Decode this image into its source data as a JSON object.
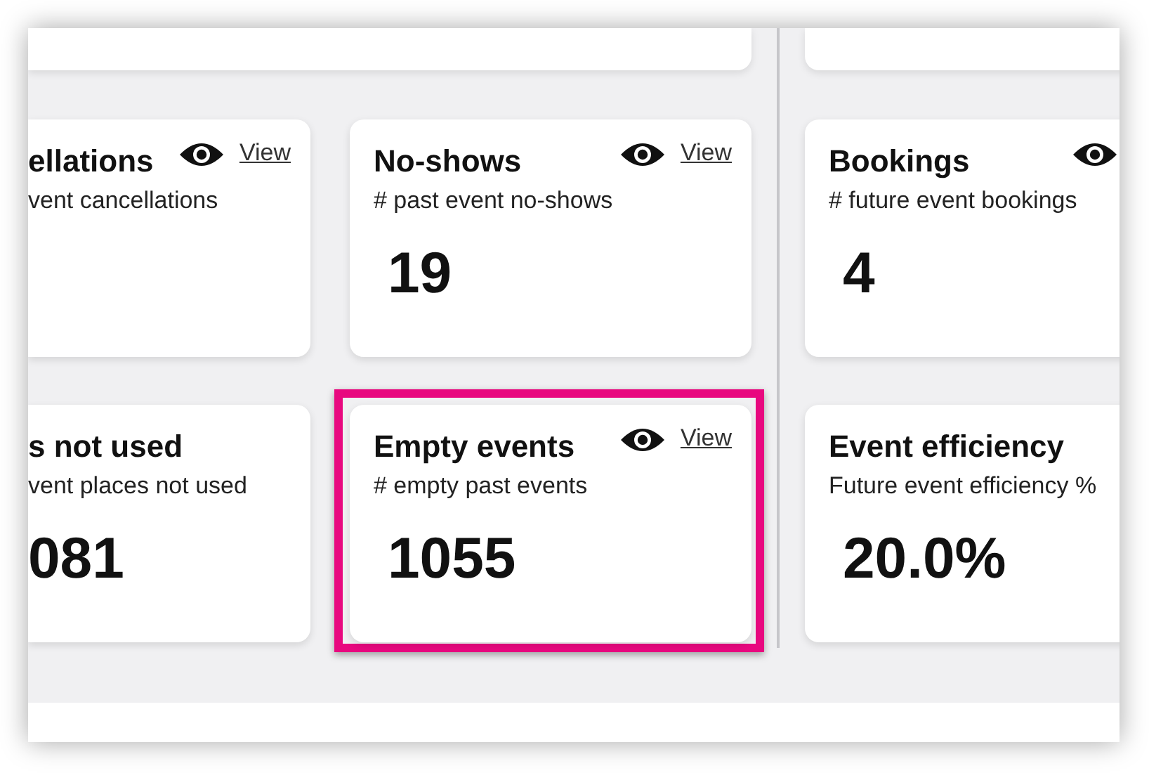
{
  "cards": [
    {
      "title": "ellations",
      "subtitle": "vent cancellations",
      "clipped_left": true,
      "show_eye": true,
      "view_label": "View",
      "highlighted": false
    },
    {
      "title": "No-shows",
      "subtitle": "# past event no-shows",
      "value": "19",
      "clipped_left": false,
      "show_eye": true,
      "view_label": "View",
      "highlighted": false
    },
    {
      "title": "Bookings",
      "subtitle": "# future event bookings",
      "value": "4",
      "clipped_left": false,
      "show_eye": true,
      "highlighted": false
    },
    {
      "title": "s not used",
      "subtitle": "vent places not used",
      "value": "081",
      "clipped_left": true,
      "show_eye": false,
      "highlighted": false
    },
    {
      "title": "Empty events",
      "subtitle": "# empty past events",
      "value": "1055",
      "clipped_left": false,
      "show_eye": true,
      "view_label": "View",
      "highlighted": true
    },
    {
      "title": "Event efficiency",
      "subtitle": "Future event efficiency %",
      "value": "20.0%",
      "clipped_left": false,
      "show_eye": false,
      "highlighted": false
    }
  ]
}
